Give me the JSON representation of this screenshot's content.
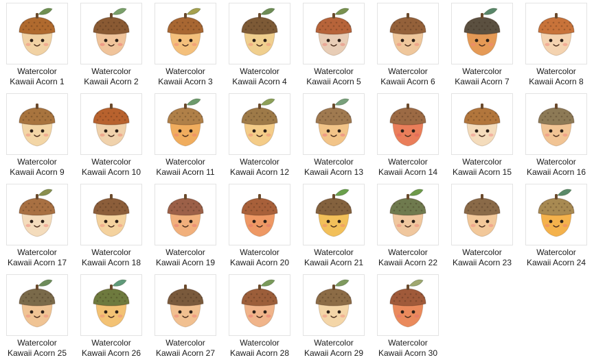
{
  "files": [
    {
      "line1": "Watercolor",
      "line2": "Kawaii Acorn 1",
      "cap": "#b06a2e",
      "body": "#f1d2a4",
      "leaf": "#6f8f52",
      "cheek": "#f0a08a"
    },
    {
      "line1": "Watercolor",
      "line2": "Kawaii Acorn 2",
      "cap": "#8a5a33",
      "body": "#f0c49b",
      "leaf": "#7aa06a",
      "cheek": "#ef8f80"
    },
    {
      "line1": "Watercolor",
      "line2": "Kawaii Acorn 3",
      "cap": "#a86732",
      "body": "#f4c07c",
      "leaf": "#a6a04e",
      "cheek": "#f29a7a"
    },
    {
      "line1": "Watercolor",
      "line2": "Kawaii Acorn 4",
      "cap": "#7d5a36",
      "body": "#f0cf8e",
      "leaf": "#6e8c55",
      "cheek": "#f1a582"
    },
    {
      "line1": "Watercolor",
      "line2": "Kawaii Acorn 5",
      "cap": "#b7643a",
      "body": "#e8cdb6",
      "leaf": "#79914f",
      "cheek": "#e99b8c"
    },
    {
      "line1": "Watercolor",
      "line2": "Kawaii Acorn 6",
      "cap": "#94613a",
      "body": "#efc79c",
      "leaf": "",
      "cheek": "#ef9c86"
    },
    {
      "line1": "Watercolor",
      "line2": "Kawaii Acorn 7",
      "cap": "#5b5040",
      "body": "#e59a56",
      "leaf": "#59866a",
      "cheek": "#ee8a6e"
    },
    {
      "line1": "Watercolor",
      "line2": "Kawaii Acorn 8",
      "cap": "#c8733a",
      "body": "#f4d3b0",
      "leaf": "",
      "cheek": "#f1a08e"
    },
    {
      "line1": "Watercolor",
      "line2": "Kawaii Acorn 9",
      "cap": "#a8743e",
      "body": "#f3d6a6",
      "leaf": "",
      "cheek": "#f0a28a"
    },
    {
      "line1": "Watercolor",
      "line2": "Kawaii Acorn 10",
      "cap": "#b8622e",
      "body": "#f0d2ac",
      "leaf": "",
      "cheek": "#ee9c86"
    },
    {
      "line1": "Watercolor",
      "line2": "Kawaii Acorn 11",
      "cap": "#b08048",
      "body": "#f0ad5e",
      "leaf": "#6c9a6c",
      "cheek": "#ef8f6c"
    },
    {
      "line1": "Watercolor",
      "line2": "Kawaii Acorn 12",
      "cap": "#9e7a48",
      "body": "#f4cc88",
      "leaf": "#8ea058",
      "cheek": "#f1a07c"
    },
    {
      "line1": "Watercolor",
      "line2": "Kawaii Acorn 13",
      "cap": "#a07a50",
      "body": "#f2c488",
      "leaf": "#78a07c",
      "cheek": "#ee8f84"
    },
    {
      "line1": "Watercolor",
      "line2": "Kawaii Acorn 14",
      "cap": "#9c6a44",
      "body": "#ea7e5a",
      "leaf": "",
      "cheek": "#e46a5c"
    },
    {
      "line1": "Watercolor",
      "line2": "Kawaii Acorn 15",
      "cap": "#b2763c",
      "body": "#f4dcbc",
      "leaf": "",
      "cheek": "#f1a698"
    },
    {
      "line1": "Watercolor",
      "line2": "Kawaii Acorn 16",
      "cap": "#8d7a56",
      "body": "#f1c494",
      "leaf": "",
      "cheek": "#ef9a86"
    },
    {
      "line1": "Watercolor",
      "line2": "Kawaii Acorn 17",
      "cap": "#a87042",
      "body": "#f4dcbc",
      "leaf": "#8a8f4e",
      "cheek": "#f0a290"
    },
    {
      "line1": "Watercolor",
      "line2": "Kawaii Acorn 18",
      "cap": "#8c5e3a",
      "body": "#f4d29e",
      "leaf": "",
      "cheek": "#f0a48a"
    },
    {
      "line1": "Watercolor",
      "line2": "Kawaii Acorn 19",
      "cap": "#9c6048",
      "body": "#f1b07c",
      "leaf": "",
      "cheek": "#ea8a78"
    },
    {
      "line1": "Watercolor",
      "line2": "Kawaii Acorn 20",
      "cap": "#a8603a",
      "body": "#ee9864",
      "leaf": "",
      "cheek": "#e6806a"
    },
    {
      "line1": "Watercolor",
      "line2": "Kawaii Acorn 21",
      "cap": "#84623e",
      "body": "#f2c05a",
      "leaf": "#6aa04c",
      "cheek": "#ef9a6a"
    },
    {
      "line1": "Watercolor",
      "line2": "Kawaii Acorn 22",
      "cap": "#6f7a4e",
      "body": "#f0c79e",
      "leaf": "#6e9a4a",
      "cheek": "#ef9c86"
    },
    {
      "line1": "Watercolor",
      "line2": "Kawaii Acorn 23",
      "cap": "#8a6a48",
      "body": "#f2c89a",
      "leaf": "",
      "cheek": "#ef9e88"
    },
    {
      "line1": "Watercolor",
      "line2": "Kawaii Acorn 24",
      "cap": "#a88a52",
      "body": "#f4b24c",
      "leaf": "#5a8a6a",
      "cheek": "#ef9064"
    },
    {
      "line1": "Watercolor",
      "line2": "Kawaii Acorn 25",
      "cap": "#7a6a4a",
      "body": "#f0c494",
      "leaf": "#6e8c5a",
      "cheek": "#ef9c84"
    },
    {
      "line1": "Watercolor",
      "line2": "Kawaii Acorn 26",
      "cap": "#6e7a3e",
      "body": "#f3c274",
      "leaf": "#5f9a7a",
      "cheek": "#ef9c78"
    },
    {
      "line1": "Watercolor",
      "line2": "Kawaii Acorn 27",
      "cap": "#7a5a3c",
      "body": "#f1c090",
      "leaf": "",
      "cheek": "#ef9480"
    },
    {
      "line1": "Watercolor",
      "line2": "Kawaii Acorn 28",
      "cap": "#9c5e3a",
      "body": "#f0b48a",
      "leaf": "#7a9a5a",
      "cheek": "#ec8a78"
    },
    {
      "line1": "Watercolor",
      "line2": "Kawaii Acorn 29",
      "cap": "#8c6c46",
      "body": "#f4d6a8",
      "leaf": "#7f9a5e",
      "cheek": "#f1a48e"
    },
    {
      "line1": "Watercolor",
      "line2": "Kawaii Acorn 30",
      "cap": "#a05a3a",
      "body": "#ea8a5c",
      "leaf": "#a0a870",
      "cheek": "#e6786a"
    }
  ]
}
